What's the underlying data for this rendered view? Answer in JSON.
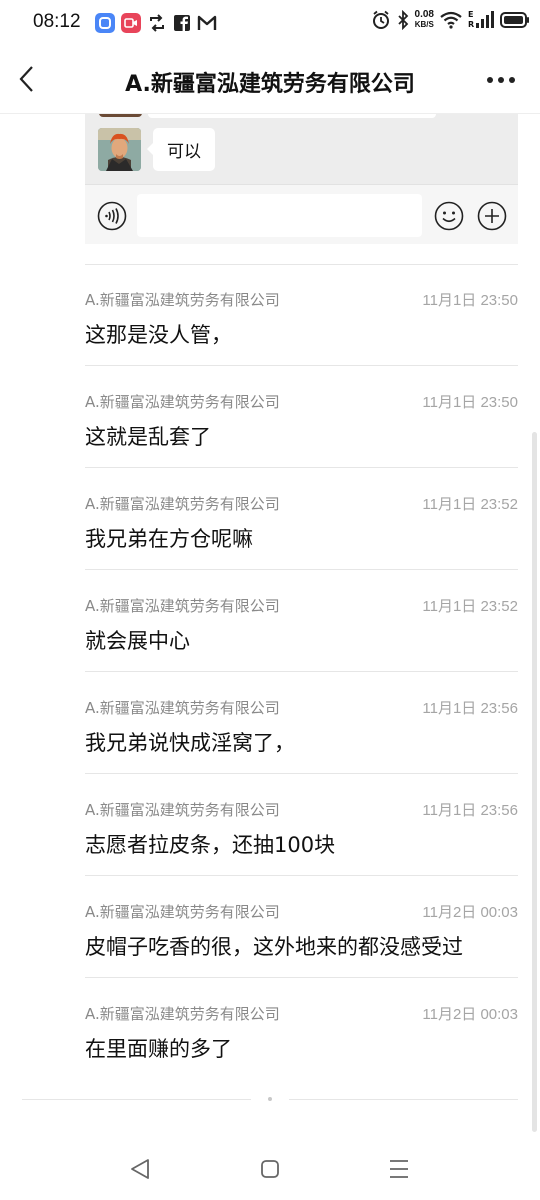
{
  "status_bar": {
    "time": "08:12",
    "network_speed_value": "0.08",
    "network_speed_unit": "KB/S",
    "signal_label_top": "E",
    "signal_label_bottom": "R",
    "icons": [
      "app-icon-blue",
      "app-icon-red-video",
      "retweet-icon",
      "facebook-icon",
      "gmail-icon",
      "alarm-icon",
      "bluetooth-icon",
      "wifi-icon",
      "signal-icon",
      "battery-icon"
    ]
  },
  "header": {
    "title": "A.新疆富泓建筑劳务有限公司"
  },
  "preview": {
    "last_message": "可以"
  },
  "messages": [
    {
      "sender": "A.新疆富泓建筑劳务有限公司",
      "time": "11月1日 23:50",
      "text": "这那是没人管，"
    },
    {
      "sender": "A.新疆富泓建筑劳务有限公司",
      "time": "11月1日 23:50",
      "text": "这就是乱套了"
    },
    {
      "sender": "A.新疆富泓建筑劳务有限公司",
      "time": "11月1日 23:52",
      "text": "我兄弟在方仓呢嘛"
    },
    {
      "sender": "A.新疆富泓建筑劳务有限公司",
      "time": "11月1日 23:52",
      "text": "就会展中心"
    },
    {
      "sender": "A.新疆富泓建筑劳务有限公司",
      "time": "11月1日 23:56",
      "text": "我兄弟说快成淫窝了，"
    },
    {
      "sender": "A.新疆富泓建筑劳务有限公司",
      "time": "11月1日 23:56",
      "text": "志愿者拉皮条，还抽100块"
    },
    {
      "sender": "A.新疆富泓建筑劳务有限公司",
      "time": "11月2日 00:03",
      "text": "皮帽子吃香的很，这外地来的都没感受过"
    },
    {
      "sender": "A.新疆富泓建筑劳务有限公司",
      "time": "11月2日 00:03",
      "text": "在里面赚的多了"
    }
  ],
  "colors": {
    "preview_bg": "#ededed",
    "divider": "#e6e6e6",
    "secondary_text": "#8a8a8a"
  }
}
